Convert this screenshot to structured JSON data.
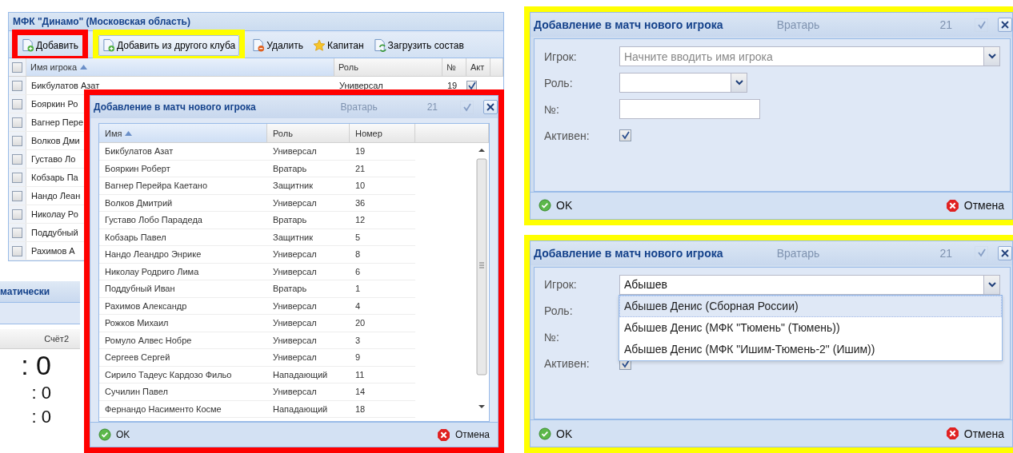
{
  "team_panel": {
    "title": "МФК \"Динамо\" (Московская область)",
    "toolbar": [
      {
        "label": "Добавить",
        "color": "#ff0000",
        "pressed": false
      },
      {
        "label": "Добавить из другого клуба",
        "color": "#ffff00",
        "pressed": true
      },
      {
        "label": "Удалить",
        "pressed": false
      },
      {
        "label": "Капитан",
        "pressed": false
      },
      {
        "label": "Загрузить состав",
        "pressed": false
      }
    ],
    "select_all_checked": false,
    "columns": [
      {
        "label": "Имя игрока",
        "sorted": true
      },
      {
        "label": "Роль",
        "sorted": false
      },
      {
        "label": "№",
        "sorted": false
      },
      {
        "label": "Акт",
        "sorted": false
      }
    ],
    "rows": [
      {
        "name": "Бикбулатов Азат",
        "role": "Универсал",
        "number": "19",
        "active": true,
        "checked": false
      },
      {
        "name": "Бояркин Ро",
        "checked": false
      },
      {
        "name": "Вагнер Пере",
        "checked": false
      },
      {
        "name": "Волков Дми",
        "checked": false
      },
      {
        "name": "Густаво Ло",
        "checked": false
      },
      {
        "name": "Кобзарь Па",
        "checked": false
      },
      {
        "name": "Нандо Леан",
        "checked": false
      },
      {
        "name": "Николау Ро",
        "checked": false
      },
      {
        "name": "Поддубный",
        "checked": false
      },
      {
        "name": "Рахимов А",
        "checked": false
      }
    ]
  },
  "lower_panel": {
    "tab": "матически",
    "score_column": "Счёт2",
    "scores": [
      ": 0",
      ": 0",
      ": 0"
    ]
  },
  "picker_dialog": {
    "title": "Добавление в матч нового игрока",
    "color": "#ff0000",
    "ghost": {
      "role": "Вратарь",
      "number": "21",
      "checked": true
    },
    "columns": [
      {
        "label": "Имя",
        "sorted": true
      },
      {
        "label": "Роль",
        "sorted": false
      },
      {
        "label": "Номер",
        "sorted": false
      }
    ],
    "rows": [
      {
        "name": "Бикбулатов Азат",
        "role": "Универсал",
        "number": "19"
      },
      {
        "name": "Бояркин Роберт",
        "role": "Вратарь",
        "number": "21"
      },
      {
        "name": "Вагнер Перейра Каетано",
        "role": "Защитник",
        "number": "10"
      },
      {
        "name": "Волков Дмитрий",
        "role": "Универсал",
        "number": "36"
      },
      {
        "name": "Густаво Лобо Парадеда",
        "role": "Вратарь",
        "number": "12"
      },
      {
        "name": "Кобзарь Павел",
        "role": "Защитник",
        "number": "5"
      },
      {
        "name": "Нандо Леандро Энрике",
        "role": "Универсал",
        "number": "8"
      },
      {
        "name": "Николау Родриго Лима",
        "role": "Универсал",
        "number": "6"
      },
      {
        "name": "Поддубный Иван",
        "role": "Вратарь",
        "number": "1"
      },
      {
        "name": "Рахимов Александр",
        "role": "Универсал",
        "number": "4"
      },
      {
        "name": "Рожков Михаил",
        "role": "Универсал",
        "number": "20"
      },
      {
        "name": "Ромуло Алвес Нобре",
        "role": "Универсал",
        "number": "3"
      },
      {
        "name": "Сергеев Сергей",
        "role": "Универсал",
        "number": "9"
      },
      {
        "name": "Сирило Тадеус Кардозо Фильо",
        "role": "Нападающий",
        "number": "11"
      },
      {
        "name": "Сучилин Павел",
        "role": "Универсал",
        "number": "14"
      },
      {
        "name": "Фернандо Насименто Косме",
        "role": "Нападающий",
        "number": "18"
      }
    ],
    "buttons": [
      {
        "kind": "ok",
        "label": "OK"
      },
      {
        "kind": "cancel",
        "label": "Отмена"
      }
    ]
  },
  "form_dialogs": [
    {
      "title": "Добавление в матч нового игрока",
      "color": "#ffff00",
      "ghost": {
        "role": "Вратарь",
        "number": "21",
        "checked": true
      },
      "fields": [
        {
          "kind": "combo",
          "label": "Игрок:",
          "placeholder": "Начните вводить имя игрока"
        },
        {
          "kind": "select",
          "label": "Роль:"
        },
        {
          "kind": "text",
          "label": "№:"
        },
        {
          "kind": "checkbox",
          "label": "Активен:",
          "checked": true
        }
      ],
      "buttons": [
        {
          "kind": "ok",
          "label": "OK"
        },
        {
          "kind": "cancel",
          "label": "Отмена"
        }
      ]
    },
    {
      "title": "Добавление в матч нового игрока",
      "color": "#ffff00",
      "ghost": {
        "role": "Вратарь",
        "number": "21",
        "checked": true
      },
      "fields": [
        {
          "kind": "combo",
          "label": "Игрок:",
          "value": "Абышев",
          "options": [
            {
              "label": "Абышев Денис (Сборная России)",
              "selected": true
            },
            {
              "label": "Абышев Денис (МФК \"Тюмень\" (Тюмень))",
              "selected": false
            },
            {
              "label": "Абышев Денис (МФК \"Ишим-Тюмень-2\" (Ишим))",
              "selected": false
            }
          ]
        },
        {
          "kind": "label",
          "label": "Роль:"
        },
        {
          "kind": "label",
          "label": "№:"
        },
        {
          "kind": "checkbox",
          "label": "Активен:",
          "checked": true
        }
      ],
      "buttons": [
        {
          "kind": "ok",
          "label": "OK"
        },
        {
          "kind": "cancel",
          "label": "Отмена"
        }
      ]
    }
  ]
}
